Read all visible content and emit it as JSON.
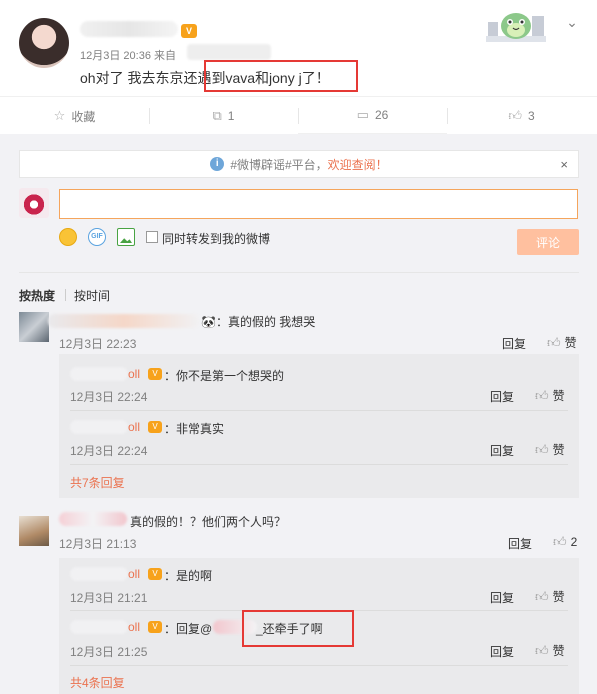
{
  "post": {
    "time": "12月3日 20:36 来自",
    "text": "oh对了 我去东京还遇到vava和jony j了！",
    "vip": "V",
    "menu_glyph": "⌄"
  },
  "actions": {
    "favorite": "收藏",
    "repost_count": "1",
    "comment_count": "26",
    "like_count": "3"
  },
  "notice": {
    "prefix": "#微博辟谣#平台，",
    "link": "欢迎查阅！",
    "close": "×"
  },
  "compose": {
    "placeholder": "",
    "gif": "GIF",
    "repost_label": "同时转发到我的微博",
    "submit": "评论"
  },
  "sort": {
    "hot": "按热度",
    "time": "按时间"
  },
  "comments": [
    {
      "text": "🐼：真的假的 我想哭",
      "date": "12月3日 22:23",
      "reply": "回复",
      "like": "赞",
      "replies": [
        {
          "name_tail": "oll",
          "text": "：你不是第一个想哭的",
          "date": "12月3日 22:24",
          "reply": "回复",
          "like": "赞"
        },
        {
          "name_tail": "oll",
          "text": "：非常真实",
          "date": "12月3日 22:24",
          "reply": "回复",
          "like": "赞"
        }
      ],
      "more": "共7条回复"
    },
    {
      "text": "真的假的！？他们两个人吗？",
      "date": "12月3日 21:13",
      "reply": "回复",
      "like": "2",
      "replies": [
        {
          "name_tail": "oll",
          "text": "：是的啊",
          "date": "12月3日 21:21",
          "reply": "回复",
          "like": "赞"
        },
        {
          "name_tail": "oll",
          "text_prefix": "：回复@",
          "text": "_还牵手了啊",
          "date": "12月3日 21:25",
          "reply": "回复",
          "like": "赞"
        }
      ],
      "more": "共4条回复"
    }
  ],
  "colors": {
    "accent": "#eb7350",
    "highlight_box": "#e53935",
    "background": "#f2f2f5"
  }
}
